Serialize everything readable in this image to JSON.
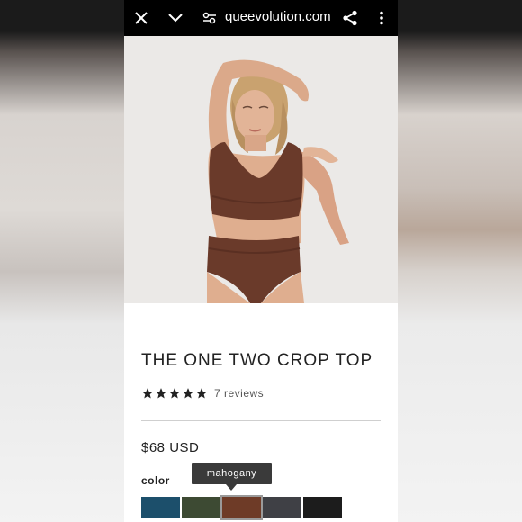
{
  "browser": {
    "url": "queevolution.com",
    "icons": [
      "close-icon",
      "chevron-down-icon",
      "tune-icon",
      "share-icon",
      "more-vert-icon"
    ]
  },
  "product": {
    "title": "THE ONE TWO CROP TOP",
    "rating": 5,
    "reviews": "7 reviews",
    "price": "$68 USD",
    "color_label": "color",
    "tooltip": "mahogany",
    "swatches": [
      {
        "name": "blue",
        "color": "#1c4f6b"
      },
      {
        "name": "olive",
        "color": "#3d4a33"
      },
      {
        "name": "mahogany",
        "color": "#6e3b27",
        "selected": true
      },
      {
        "name": "charcoal",
        "color": "#3f4045"
      },
      {
        "name": "black",
        "color": "#1c1c1c"
      }
    ]
  },
  "colors": {
    "topbar": "#000000",
    "garment": "#6a3a2a",
    "star": "#222222"
  }
}
